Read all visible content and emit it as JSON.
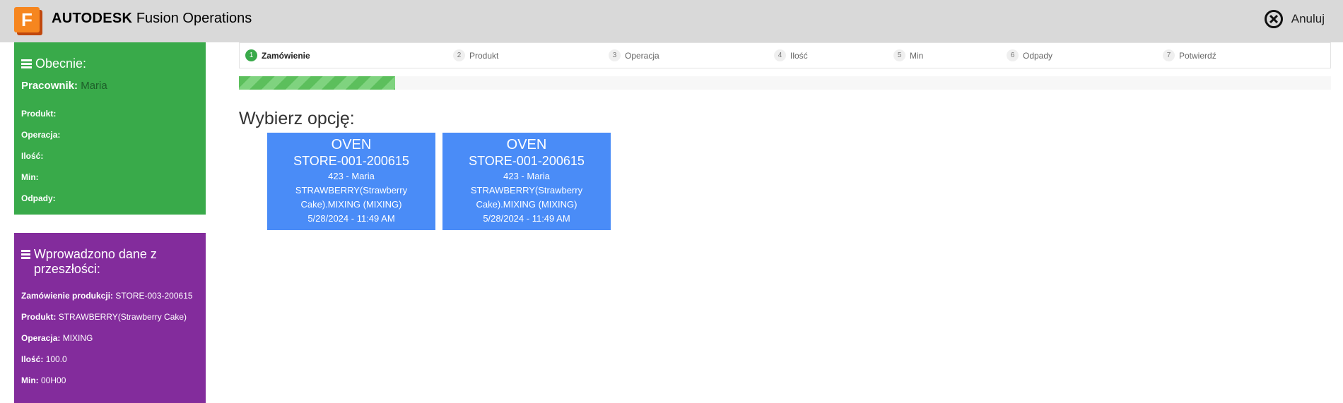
{
  "header": {
    "logo_letter": "F",
    "brand_bold": "AUTODESK",
    "brand_rest": "Fusion Operations",
    "cancel_label": "Anuluj"
  },
  "current_panel": {
    "title": "Obecnie:",
    "worker_label": "Pracownik:",
    "worker_value": "Maria",
    "fields": [
      {
        "label": "Produkt:",
        "value": ""
      },
      {
        "label": "Operacja:",
        "value": ""
      },
      {
        "label": "Ilość:",
        "value": ""
      },
      {
        "label": "Min:",
        "value": ""
      },
      {
        "label": "Odpady:",
        "value": ""
      }
    ],
    "color": "#39aa4a"
  },
  "past_panel": {
    "title": "Wprowadzono dane z przeszłości:",
    "fields": [
      {
        "label": "Zamówienie produkcji:",
        "value": "STORE-003-200615"
      },
      {
        "label": "Produkt:",
        "value": "STRAWBERRY(Strawberry Cake)"
      },
      {
        "label": "Operacja:",
        "value": "MIXING"
      },
      {
        "label": "Ilość:",
        "value": "100.0"
      },
      {
        "label": "Min:",
        "value": "00H00"
      }
    ],
    "color": "#832c9c"
  },
  "steps": [
    {
      "num": "1",
      "label": "Zamówienie",
      "active": true
    },
    {
      "num": "2",
      "label": "Produkt",
      "active": false
    },
    {
      "num": "3",
      "label": "Operacja",
      "active": false
    },
    {
      "num": "4",
      "label": "Ilość",
      "active": false
    },
    {
      "num": "5",
      "label": "Min",
      "active": false
    },
    {
      "num": "6",
      "label": "Odpady",
      "active": false
    },
    {
      "num": "7",
      "label": "Potwierdź",
      "active": false
    }
  ],
  "progress_fraction": 0.143,
  "main": {
    "heading": "Wybierz opcję:"
  },
  "cards": [
    {
      "line1": "OVEN",
      "line2": "STORE-001-200615",
      "line3": "423 - Maria",
      "line4": "STRAWBERRY(Strawberry Cake).MIXING (MIXING)",
      "line5": "5/28/2024 - 11:49 AM"
    },
    {
      "line1": "OVEN",
      "line2": "STORE-001-200615",
      "line3": "423 - Maria",
      "line4": "STRAWBERRY(Strawberry Cake).MIXING (MIXING)",
      "line5": "5/28/2024 - 11:49 AM"
    }
  ],
  "colors": {
    "card": "#4a8cf7",
    "accent": "#39aa4a",
    "topbar": "#d9d9d9"
  }
}
